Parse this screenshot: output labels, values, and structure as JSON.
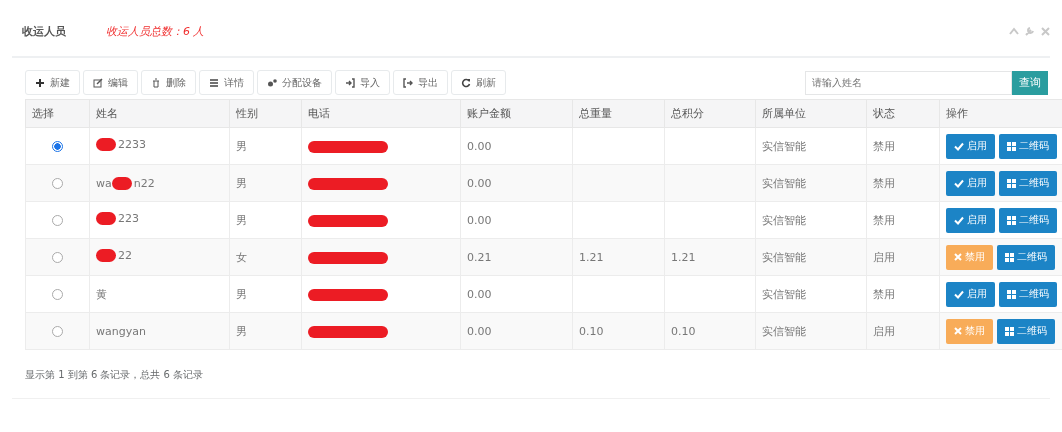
{
  "panel": {
    "title": "收运人员",
    "summary": "收运人员总数：6 人"
  },
  "toolbar": [
    {
      "kind": "plus",
      "label": "新建"
    },
    {
      "kind": "edit",
      "label": "编辑"
    },
    {
      "kind": "trash",
      "label": "删除"
    },
    {
      "kind": "list",
      "label": "详情"
    },
    {
      "kind": "gears",
      "label": "分配设备"
    },
    {
      "kind": "import",
      "label": "导入"
    },
    {
      "kind": "export",
      "label": "导出"
    },
    {
      "kind": "refresh",
      "label": "刷新"
    }
  ],
  "search": {
    "placeholder": "请输入姓名",
    "button": "查询"
  },
  "table": {
    "columns": [
      "选择",
      "姓名",
      "性别",
      "电话",
      "账户金额",
      "总重量",
      "总积分",
      "所属单位",
      "状态",
      "操作"
    ],
    "rows": [
      {
        "selected": true,
        "name": [
          {
            "kind": "redaction"
          },
          {
            "kind": "text",
            "text": "2233"
          }
        ],
        "gender": "男",
        "phone_redacted": true,
        "balance": "0.00",
        "weight": "",
        "points": "",
        "unit": "实信智能",
        "status": "禁用",
        "action": {
          "kind": "enable",
          "label": "启用"
        },
        "qr": "二维码"
      },
      {
        "selected": false,
        "name": [
          {
            "kind": "text",
            "text": "wa"
          },
          {
            "kind": "redaction"
          },
          {
            "kind": "text",
            "text": "n22"
          }
        ],
        "gender": "男",
        "phone_redacted": true,
        "balance": "0.00",
        "weight": "",
        "points": "",
        "unit": "实信智能",
        "status": "禁用",
        "action": {
          "kind": "enable",
          "label": "启用"
        },
        "qr": "二维码"
      },
      {
        "selected": false,
        "name": [
          {
            "kind": "redaction"
          },
          {
            "kind": "text",
            "text": "223"
          }
        ],
        "gender": "男",
        "phone_redacted": true,
        "balance": "0.00",
        "weight": "",
        "points": "",
        "unit": "实信智能",
        "status": "禁用",
        "action": {
          "kind": "enable",
          "label": "启用"
        },
        "qr": "二维码"
      },
      {
        "selected": false,
        "name": [
          {
            "kind": "redaction"
          },
          {
            "kind": "text",
            "text": "22"
          }
        ],
        "gender": "女",
        "phone_redacted": true,
        "balance": "0.21",
        "weight": "1.21",
        "points": "1.21",
        "unit": "实信智能",
        "status": "启用",
        "action": {
          "kind": "disable",
          "label": "禁用"
        },
        "qr": "二维码"
      },
      {
        "selected": false,
        "name": [
          {
            "kind": "text",
            "text": "黄"
          }
        ],
        "gender": "男",
        "phone_redacted": true,
        "balance": "0.00",
        "weight": "",
        "points": "",
        "unit": "实信智能",
        "status": "禁用",
        "action": {
          "kind": "enable",
          "label": "启用"
        },
        "qr": "二维码"
      },
      {
        "selected": false,
        "name": [
          {
            "kind": "text",
            "text": "wangyan"
          }
        ],
        "gender": "男",
        "phone_redacted": true,
        "balance": "0.00",
        "weight": "0.10",
        "points": "0.10",
        "unit": "实信智能",
        "status": "启用",
        "action": {
          "kind": "disable",
          "label": "禁用"
        },
        "qr": "二维码"
      }
    ]
  },
  "footer": "显示第 1 到第 6 条记录，总共 6 条记录"
}
